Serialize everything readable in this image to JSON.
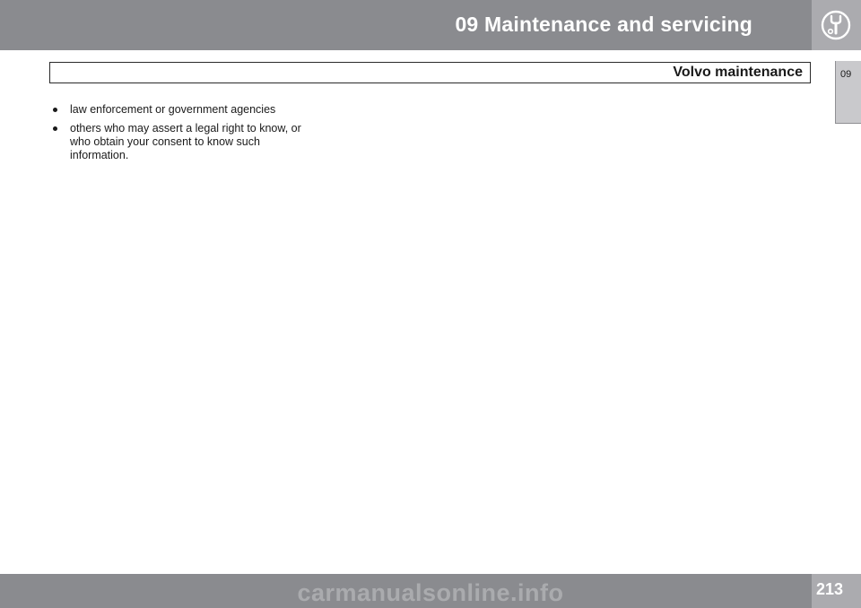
{
  "header": {
    "chapter_title": "09 Maintenance and servicing",
    "chapter_icon": "wrench-icon"
  },
  "section": {
    "title": "Volvo maintenance"
  },
  "side_tab": {
    "label": "09"
  },
  "content": {
    "bullets": [
      "law enforcement or government agencies",
      "others who may assert a legal right to know, or who obtain your consent to know such information."
    ]
  },
  "footer": {
    "page_number": "213",
    "watermark": "carmanualsonline.info"
  },
  "colors": {
    "header_band": "#8a8b8f",
    "icon_box": "#ababaf",
    "side_tab": "#c9c9cc",
    "text": "#1a1a1a"
  }
}
